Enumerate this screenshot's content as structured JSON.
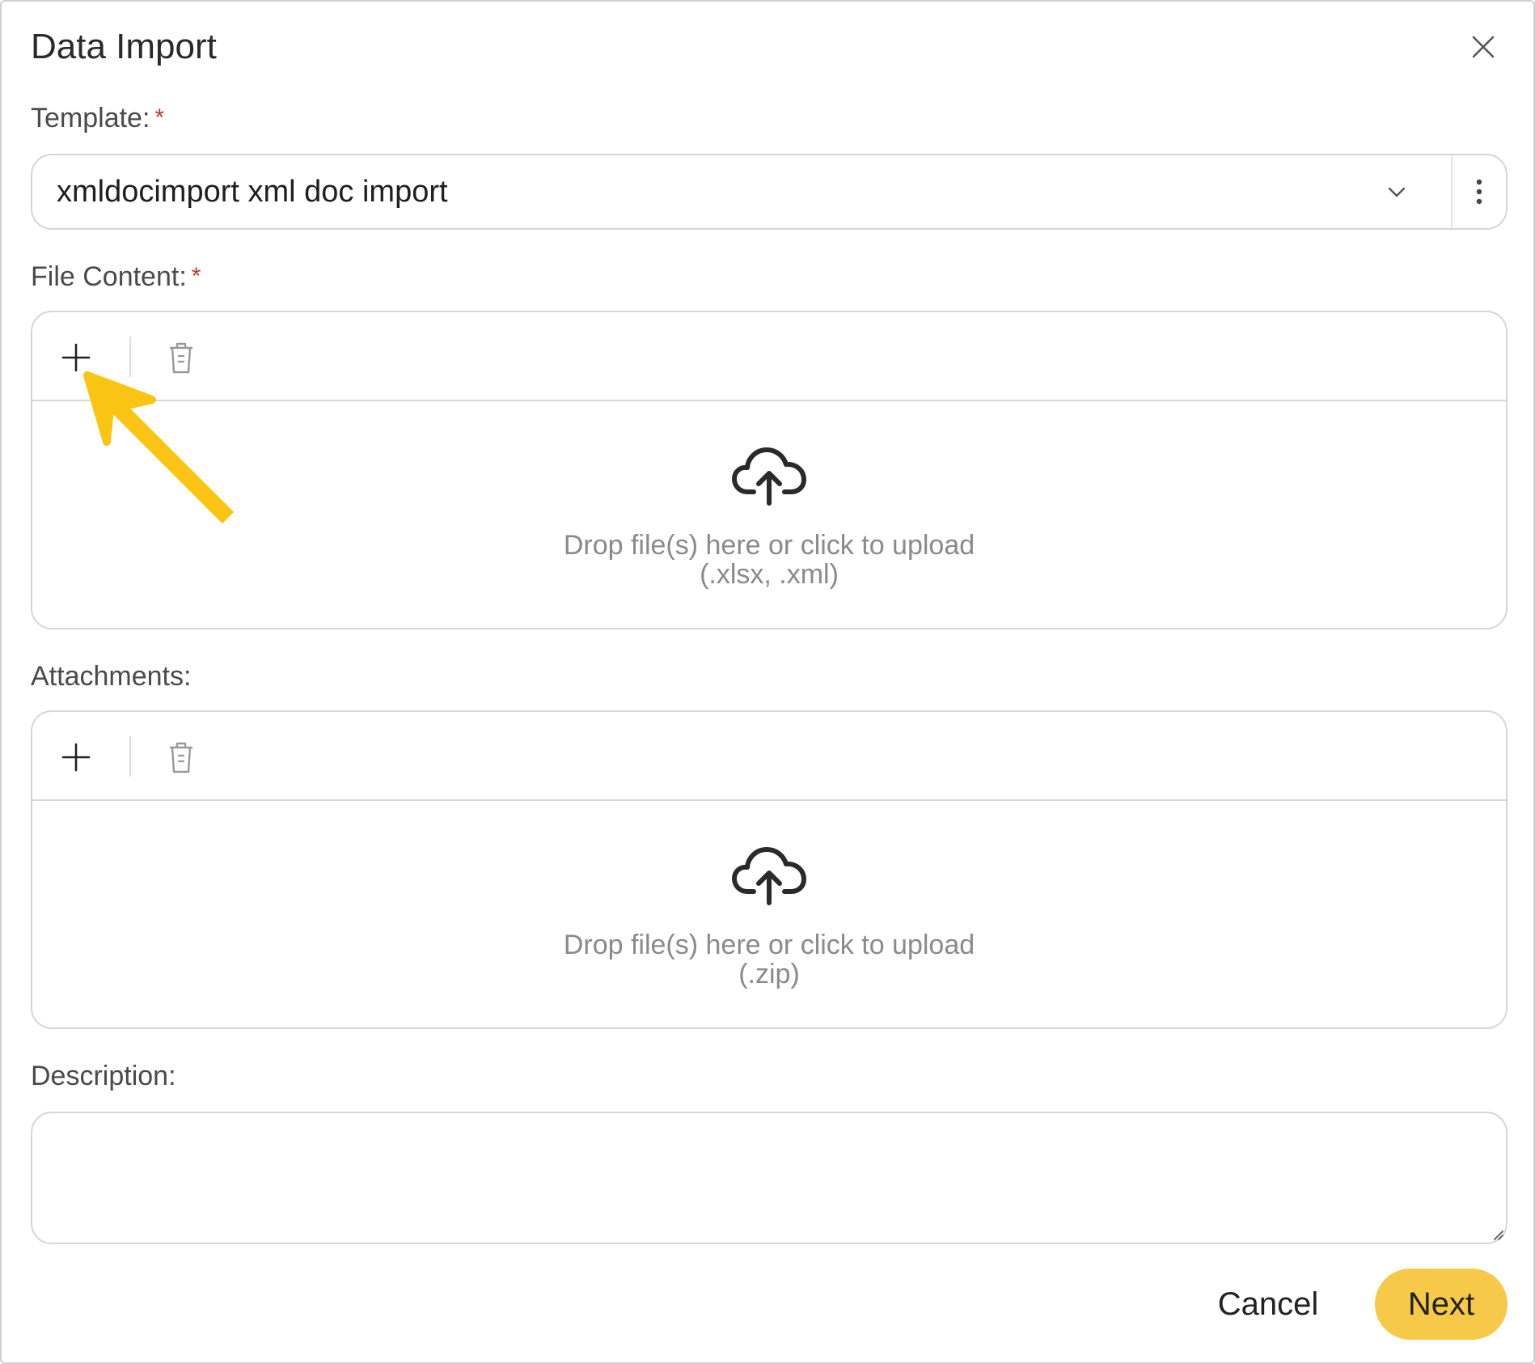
{
  "dialog": {
    "title": "Data Import"
  },
  "template": {
    "label": "Template:",
    "required_mark": "*",
    "value": "xmldocimport xml doc import"
  },
  "file_content": {
    "label": "File Content:",
    "required_mark": "*",
    "drop_text": "Drop file(s) here or click to upload",
    "accepted": "(.xlsx, .xml)"
  },
  "attachments": {
    "label": "Attachments:",
    "drop_text": "Drop file(s) here or click to upload",
    "accepted": "(.zip)"
  },
  "description": {
    "label": "Description:",
    "value": ""
  },
  "footer": {
    "cancel_label": "Cancel",
    "next_label": "Next"
  },
  "colors": {
    "accent": "#f7c948",
    "required": "#c0392b",
    "annotation_arrow": "#f9c512"
  }
}
